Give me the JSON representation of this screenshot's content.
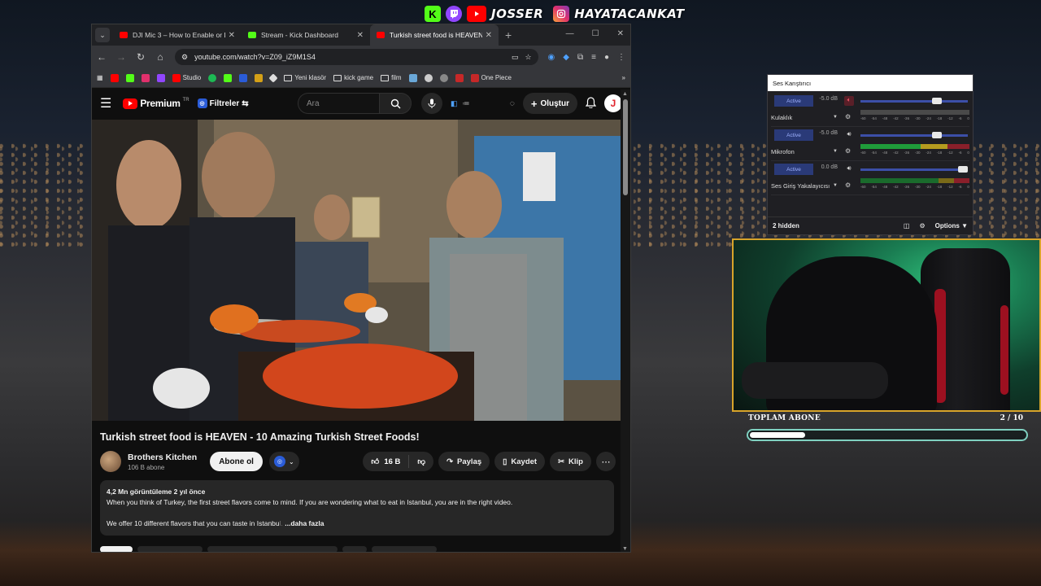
{
  "overlay": {
    "social_name_youtube": "JOSSER",
    "social_name_instagram": "HAYATACANKAT",
    "goal_label": "TOPLAM ABONE",
    "goal_count": "2 / 10",
    "goal_progress": 0.2
  },
  "browser": {
    "tabs": [
      {
        "label": "DJI Mic 3 – How to Enable or D",
        "close": "✕",
        "favicon_color": "#ff0000",
        "active": false
      },
      {
        "label": "Stream - Kick Dashboard",
        "close": "✕",
        "favicon_color": "#53fc18",
        "active": false
      },
      {
        "label": "Turkish street food is HEAVEN",
        "close": "✕",
        "favicon_color": "#ff0000",
        "active": true
      }
    ],
    "url": "youtube.com/watch?v=Z09_iZ9M1S4",
    "bookmarks": [
      "Studio",
      "Yeni klasör",
      "kick game",
      "film",
      "One Piece"
    ]
  },
  "youtube": {
    "logo_text": "Premium",
    "logo_sup": "TR",
    "filters_label": "Filtreler",
    "search_placeholder": "Ara",
    "create_label": "Oluştur",
    "avatar_letter": "J",
    "video_title": "Turkish street food is HEAVEN - 10 Amazing Turkish Street Foods!",
    "channel_name": "Brothers Kitchen",
    "channel_subs": "106 B abone",
    "subscribe_label": "Abone ol",
    "like_count": "16 B",
    "share_label": "Paylaş",
    "save_label": "Kaydet",
    "clip_label": "Klip",
    "desc_stats": "4,2 Mn görüntüleme  2 yıl önce",
    "desc_line1": "When you think of Turkey, the first street flavors come to mind. If you are wondering what to eat in Istanbul, you are in the right video.",
    "desc_line2": "We offer 10 different flavors that you can taste in Istanbu",
    "desc_fade": "l.",
    "desc_more": "...daha fazla"
  },
  "mixer": {
    "title": "Ses Karıştırıcı",
    "tracks": [
      {
        "name": "Kulaklık",
        "status": "Active",
        "db": "-5.0 dB",
        "muted": true,
        "level": 0.78
      },
      {
        "name": "Mikrofon",
        "status": "Active",
        "db": "-5.0 dB",
        "muted": false,
        "level": 0.78
      },
      {
        "name": "Ses Giriş Yakalayıcısı",
        "status": "Active",
        "db": "0.0 dB",
        "muted": false,
        "level": 0.98
      }
    ],
    "scale": [
      "-60",
      "-54",
      "-48",
      "-42",
      "-36",
      "-30",
      "-24",
      "-18",
      "-12",
      "-6",
      "0"
    ],
    "hidden_label": "2 hidden",
    "options_label": "Options"
  },
  "colors": {
    "accent_red": "#ff0000",
    "kick_green": "#53fc18",
    "twitch_purple": "#9146ff",
    "goal_border": "#7fd0c0",
    "webcam_border": "#d8a42a"
  }
}
